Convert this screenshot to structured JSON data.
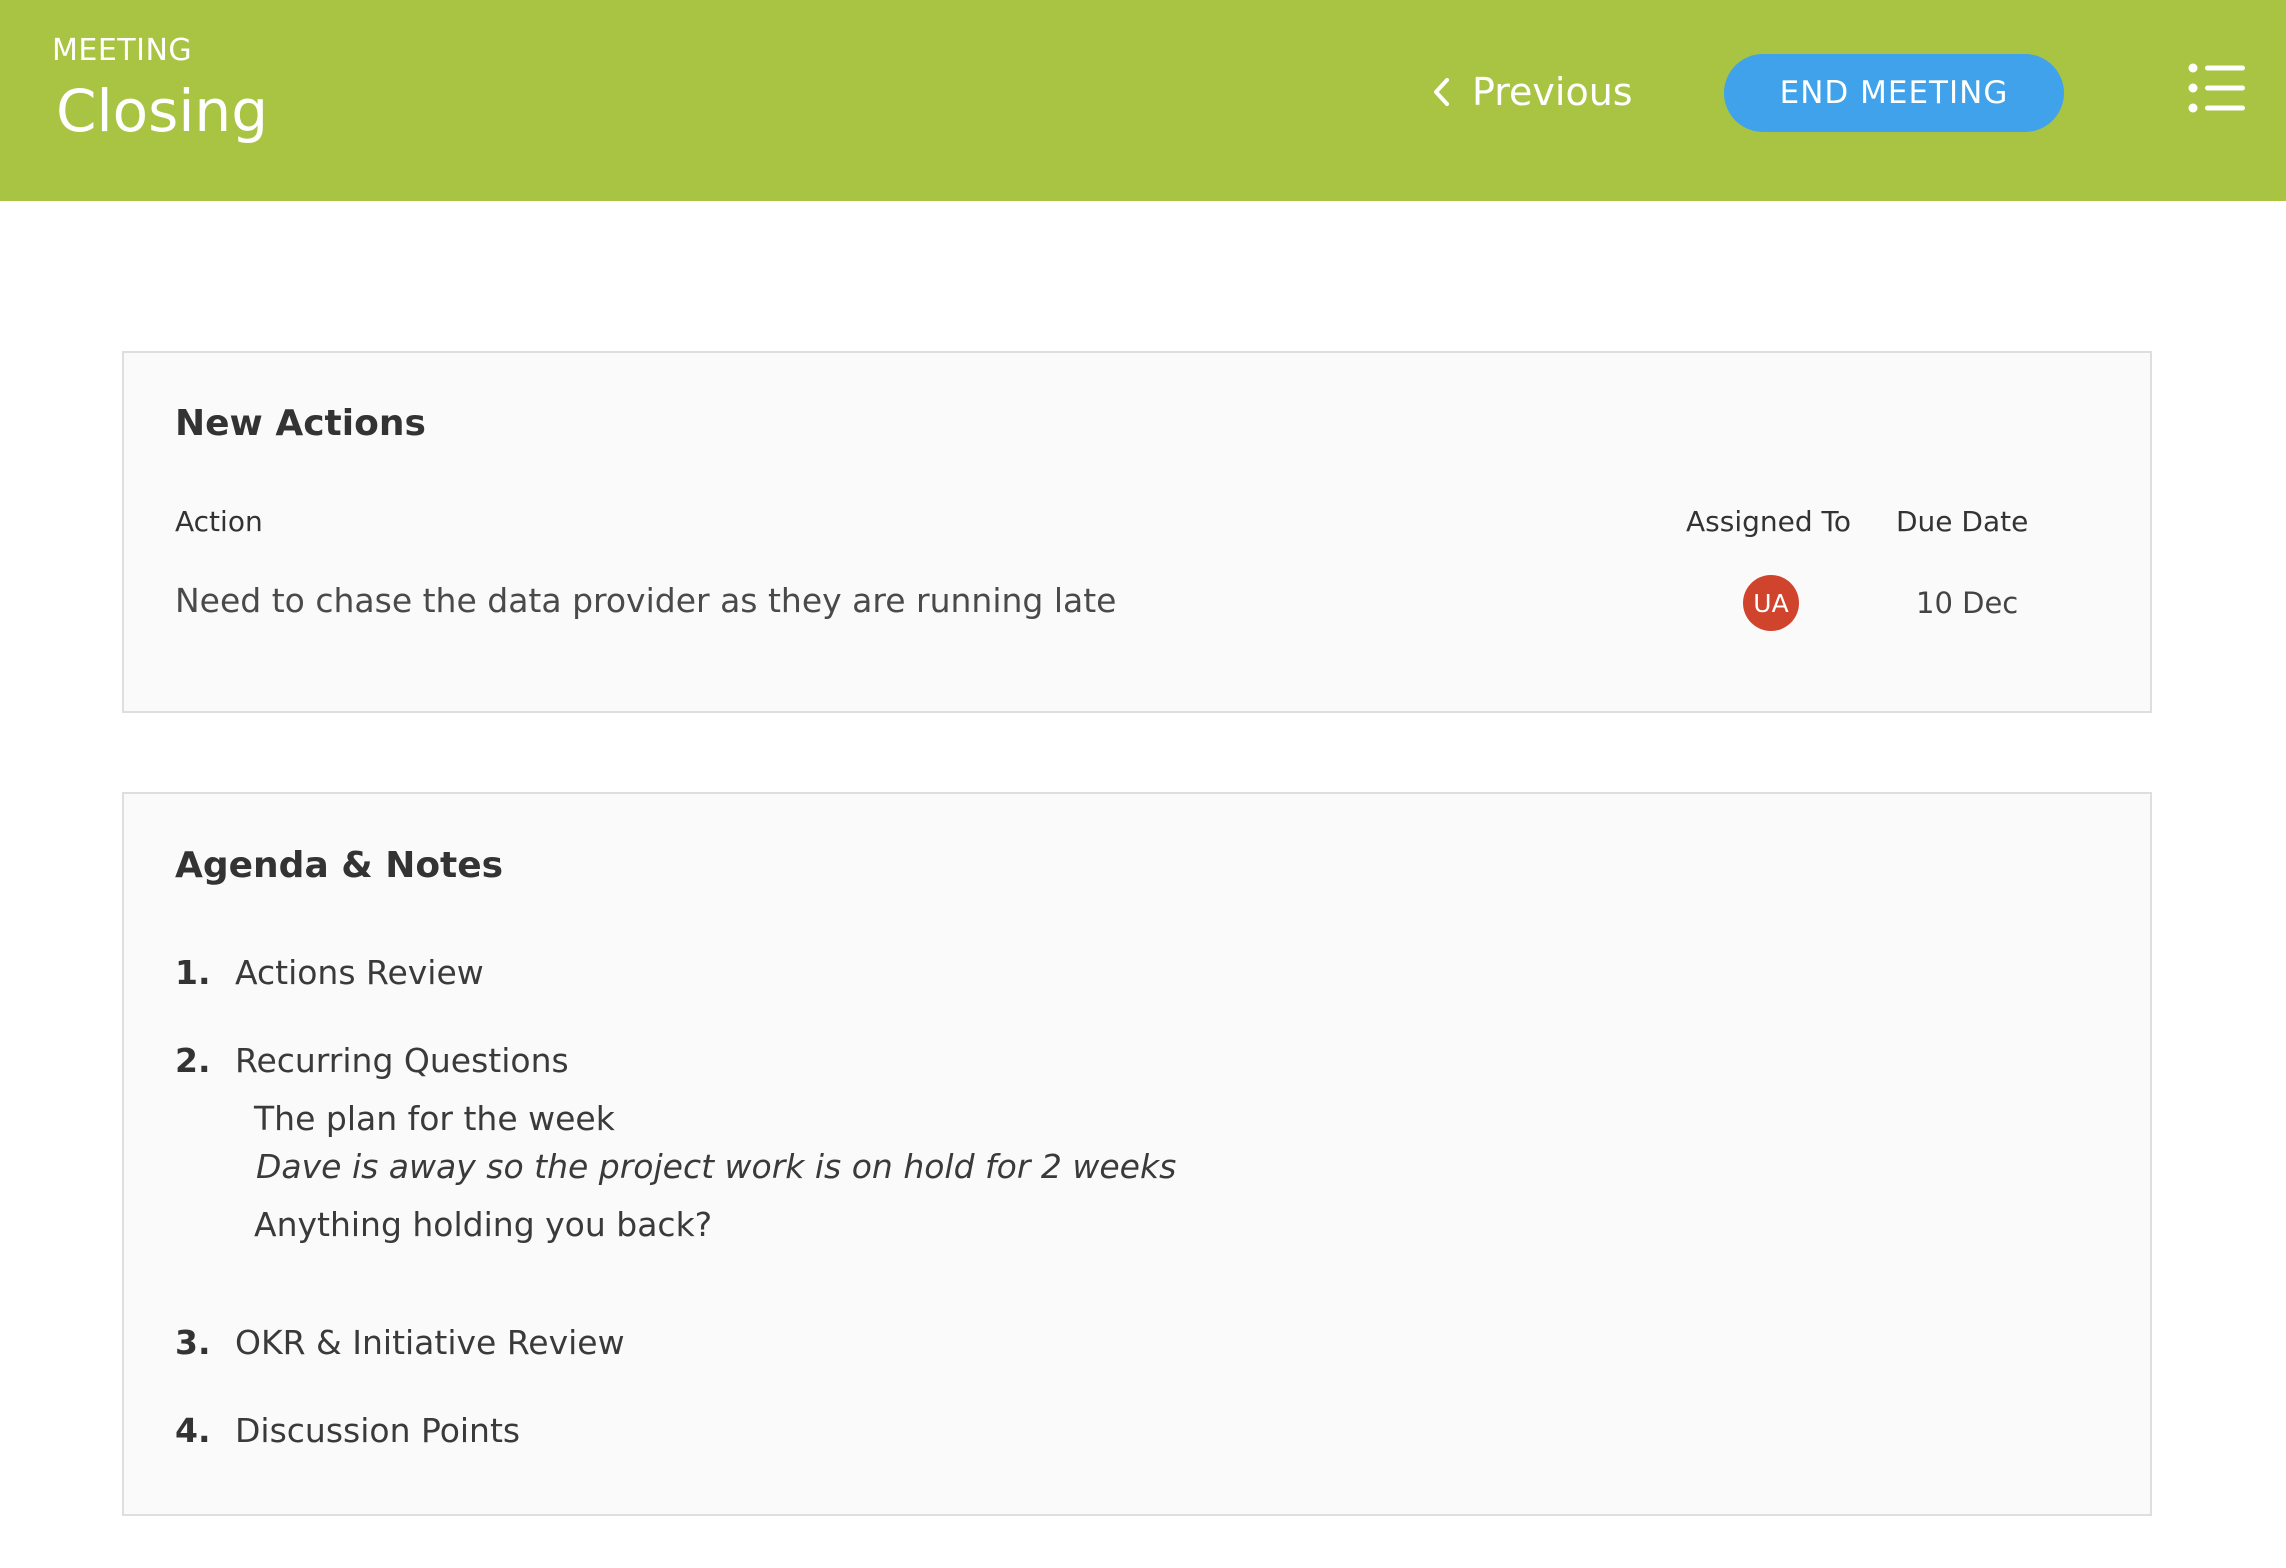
{
  "header": {
    "eyebrow": "MEETING",
    "title": "Closing",
    "previous_label": "Previous",
    "end_label": "END MEETING",
    "background": "#a9c443",
    "end_color": "#3fa2ea",
    "icons": {
      "previous": "chevron-left-icon",
      "menu": "list-menu-icon"
    }
  },
  "new_actions": {
    "title": "New Actions",
    "columns": {
      "action": "Action",
      "assigned_to": "Assigned To",
      "due_date": "Due Date"
    },
    "rows": [
      {
        "action": "Need to chase the data provider as they are running late",
        "assignee_initials": "UA",
        "avatar_color": "#d0432c",
        "due": "10 Dec"
      }
    ]
  },
  "agenda": {
    "title": "Agenda & Notes",
    "items": [
      {
        "num": "1.",
        "label": "Actions Review"
      },
      {
        "num": "2.",
        "label": "Recurring Questions"
      },
      {
        "num": "3.",
        "label": "OKR & Initiative Review"
      },
      {
        "num": "4.",
        "label": "Discussion Points"
      }
    ],
    "questions": [
      {
        "text": "The plan for the week",
        "note": "Dave is away so the project work is on hold for 2 weeks"
      },
      {
        "text": "Anything holding you back?"
      }
    ]
  }
}
